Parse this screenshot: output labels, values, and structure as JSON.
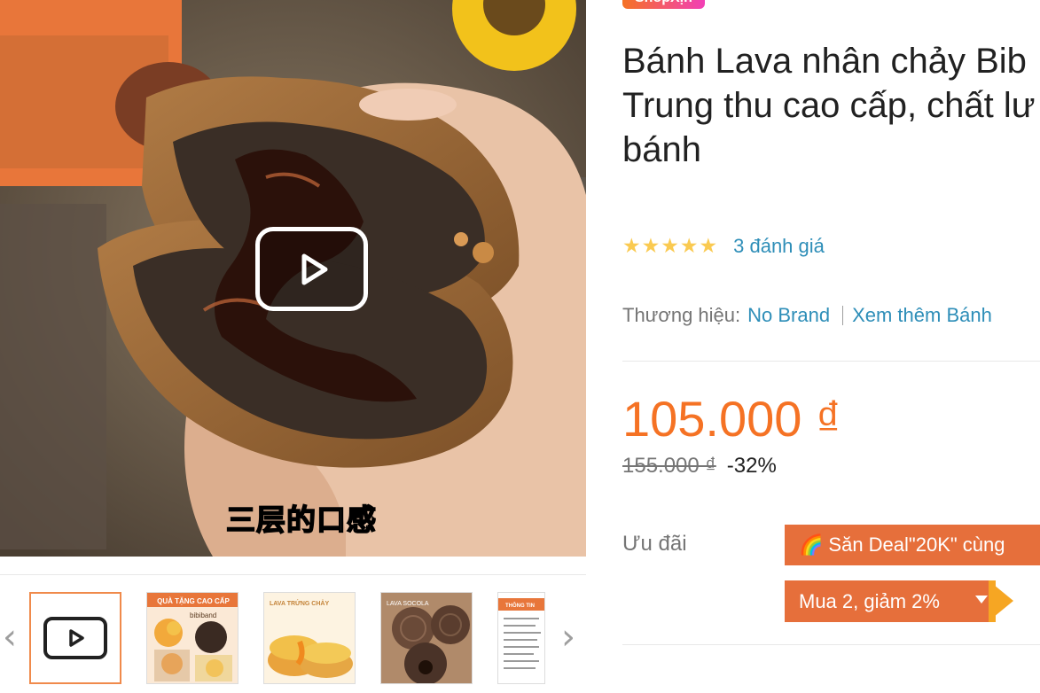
{
  "gallery": {
    "caption_overlay": "三层的口感",
    "play_icon": "play-icon",
    "thumbnails": [
      {
        "kind": "video",
        "icon": "video-play-icon"
      },
      {
        "kind": "image",
        "banner": "QUÀ TẶNG CAO CẤP",
        "brand": "bibiband"
      },
      {
        "kind": "image",
        "banner": "LAVA TRỨNG CHẢY"
      },
      {
        "kind": "image",
        "banner": "LAVA SOCOLA"
      },
      {
        "kind": "image",
        "banner": "THÔNG TIN"
      }
    ],
    "prev_icon": "chevron-left-icon",
    "next_icon": "chevron-right-icon"
  },
  "product": {
    "shop_badge": "ShopXịn",
    "title_lines": [
      "Bánh Lava nhân chảy Bib",
      "Trung thu cao cấp, chất lư",
      "bánh"
    ],
    "rating": {
      "stars": 5,
      "reviews_text": "3 đánh giá"
    },
    "brand": {
      "label": "Thương hiệu:",
      "value": "No Brand",
      "more": "Xem thêm Bánh"
    },
    "price": {
      "current": "105.000 ₫",
      "original": "155.000 ₫",
      "discount": "-32%"
    },
    "promotions": {
      "label": "Ưu đãi",
      "deal_icon": "🌈",
      "deal_text": "Săn Deal\"20K\" cùng",
      "buy_more": "Mua 2, giảm 2%"
    }
  },
  "colors": {
    "price": "#f57224",
    "link": "#2e8eb8",
    "promo": "#e66f3b",
    "star": "#faca51"
  }
}
